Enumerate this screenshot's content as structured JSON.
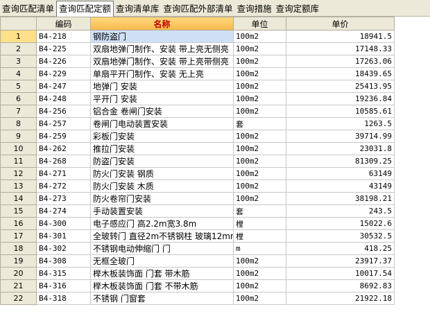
{
  "tabs": [
    {
      "label": "查询匹配清单",
      "active": false
    },
    {
      "label": "查询匹配定额",
      "active": true
    },
    {
      "label": "查询清单库",
      "active": false
    },
    {
      "label": "查询匹配外部清单",
      "active": false
    },
    {
      "label": "查询措施",
      "active": false
    },
    {
      "label": "查询定额库",
      "active": false
    }
  ],
  "columns": {
    "code": "编码",
    "name": "名称",
    "unit": "单位",
    "price": "单价"
  },
  "rows": [
    {
      "idx": "1",
      "code": "B4-218",
      "name": "钢防盗门",
      "unit": "100m2",
      "price": "18941.5"
    },
    {
      "idx": "2",
      "code": "B4-225",
      "name": "双扇地弹门制作、安装 带上亮无侧亮",
      "unit": "100m2",
      "price": "17148.33"
    },
    {
      "idx": "3",
      "code": "B4-226",
      "name": "双扇地弹门制作、安装 带上亮带侧亮",
      "unit": "100m2",
      "price": "17263.06"
    },
    {
      "idx": "4",
      "code": "B4-229",
      "name": "单扇平开门制作、安装 无上亮",
      "unit": "100m2",
      "price": "18439.65"
    },
    {
      "idx": "5",
      "code": "B4-247",
      "name": "地弹门 安装",
      "unit": "100m2",
      "price": "25413.95"
    },
    {
      "idx": "6",
      "code": "B4-248",
      "name": "平开门 安装",
      "unit": "100m2",
      "price": "19236.84"
    },
    {
      "idx": "7",
      "code": "B4-256",
      "name": "铝合金 卷闸门安装",
      "unit": "100m2",
      "price": "10585.61"
    },
    {
      "idx": "8",
      "code": "B4-257",
      "name": "卷闸门电动装置安装",
      "unit": "套",
      "price": "1263.5"
    },
    {
      "idx": "9",
      "code": "B4-259",
      "name": "彩板门安装",
      "unit": "100m2",
      "price": "39714.99"
    },
    {
      "idx": "10",
      "code": "B4-262",
      "name": "推拉门安装",
      "unit": "100m2",
      "price": "23031.8"
    },
    {
      "idx": "11",
      "code": "B4-268",
      "name": "防盗门安装",
      "unit": "100m2",
      "price": "81309.25"
    },
    {
      "idx": "12",
      "code": "B4-271",
      "name": "防火门安装 钢质",
      "unit": "100m2",
      "price": "63149"
    },
    {
      "idx": "13",
      "code": "B4-272",
      "name": "防火门安装 木质",
      "unit": "100m2",
      "price": "43149"
    },
    {
      "idx": "14",
      "code": "B4-273",
      "name": "防火卷帘门安装",
      "unit": "100m2",
      "price": "38198.21"
    },
    {
      "idx": "15",
      "code": "B4-274",
      "name": "手动装置安装",
      "unit": "套",
      "price": "243.5"
    },
    {
      "idx": "16",
      "code": "B4-300",
      "name": "电子感应门 高2.2m宽3.8m",
      "unit": "樘",
      "price": "15022.6"
    },
    {
      "idx": "17",
      "code": "B4-301",
      "name": "全玻转门 直径2m不锈钢柱 玻璃12mm",
      "unit": "樘",
      "price": "30532.5"
    },
    {
      "idx": "18",
      "code": "B4-302",
      "name": "不锈钢电动伸缩门 门",
      "unit": "m",
      "price": "418.25"
    },
    {
      "idx": "19",
      "code": "B4-308",
      "name": "无框全玻门",
      "unit": "100m2",
      "price": "23917.37"
    },
    {
      "idx": "20",
      "code": "B4-315",
      "name": "榉木板装饰面 门套 带木筋",
      "unit": "100m2",
      "price": "10017.54"
    },
    {
      "idx": "21",
      "code": "B4-316",
      "name": "榉木板装饰面 门套 不带木筋",
      "unit": "100m2",
      "price": "8692.83"
    },
    {
      "idx": "22",
      "code": "B4-318",
      "name": "不锈钢 门窗套",
      "unit": "100m2",
      "price": "21922.18"
    }
  ]
}
